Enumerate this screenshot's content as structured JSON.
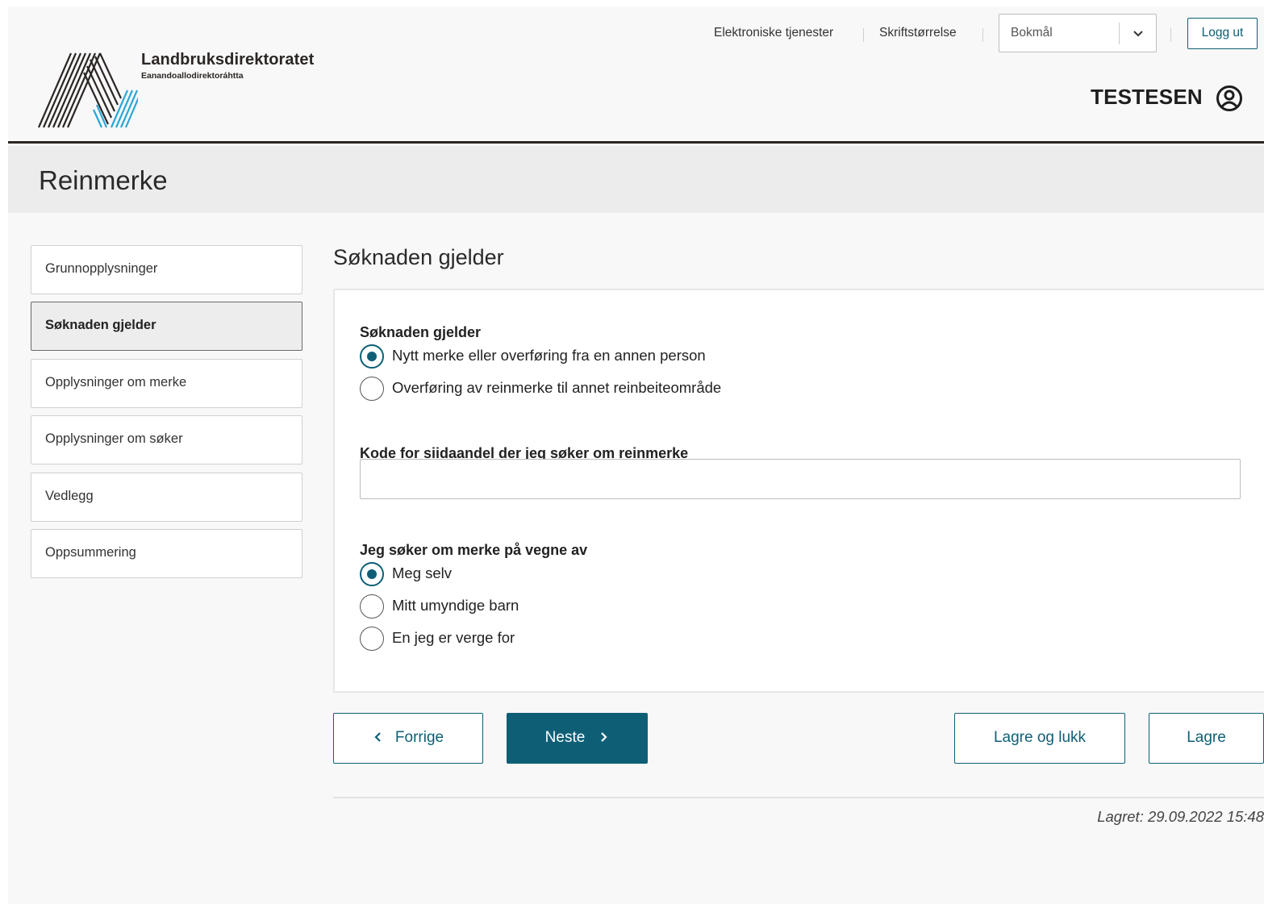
{
  "header": {
    "logo_name": "Landbruksdirektoratet",
    "logo_subtitle": "Eanandoallodirektoráhtta",
    "links": {
      "electronic_services": "Elektroniske tjenester",
      "font_size": "Skriftstørrelse"
    },
    "language": {
      "selected": "Bokmål"
    },
    "logout_label": "Logg ut",
    "username": "TESTESEN"
  },
  "page_title": "Reinmerke",
  "sidebar": {
    "items": [
      {
        "label": "Grunnopplysninger",
        "active": false
      },
      {
        "label": "Søknaden gjelder",
        "active": true
      },
      {
        "label": "Opplysninger om merke",
        "active": false
      },
      {
        "label": "Opplysninger om søker",
        "active": false
      },
      {
        "label": "Vedlegg",
        "active": false
      },
      {
        "label": "Oppsummering",
        "active": false
      }
    ]
  },
  "main": {
    "section_title": "Søknaden gjelder",
    "question1": {
      "label": "Søknaden gjelder",
      "options": [
        {
          "label": "Nytt merke eller overføring fra en annen person",
          "checked": true
        },
        {
          "label": "Overføring av reinmerke til annet reinbeiteområde",
          "checked": false
        }
      ]
    },
    "siida_code": {
      "label": "Kode for siidaandel der jeg søker om reinmerke",
      "value": ""
    },
    "question2": {
      "label": "Jeg søker om merke på vegne av",
      "options": [
        {
          "label": "Meg selv",
          "checked": true
        },
        {
          "label": "Mitt umyndige barn",
          "checked": false
        },
        {
          "label": "En jeg er verge for",
          "checked": false
        }
      ]
    }
  },
  "buttons": {
    "previous": "Forrige",
    "next": "Neste",
    "save_close": "Lagre og lukk",
    "save": "Lagre"
  },
  "saved_status": "Lagret: 29.09.2022 15:48",
  "colors": {
    "accent": "#0e5f76",
    "header_rule": "#2b2624",
    "logo_blue": "#2aa6d6"
  }
}
